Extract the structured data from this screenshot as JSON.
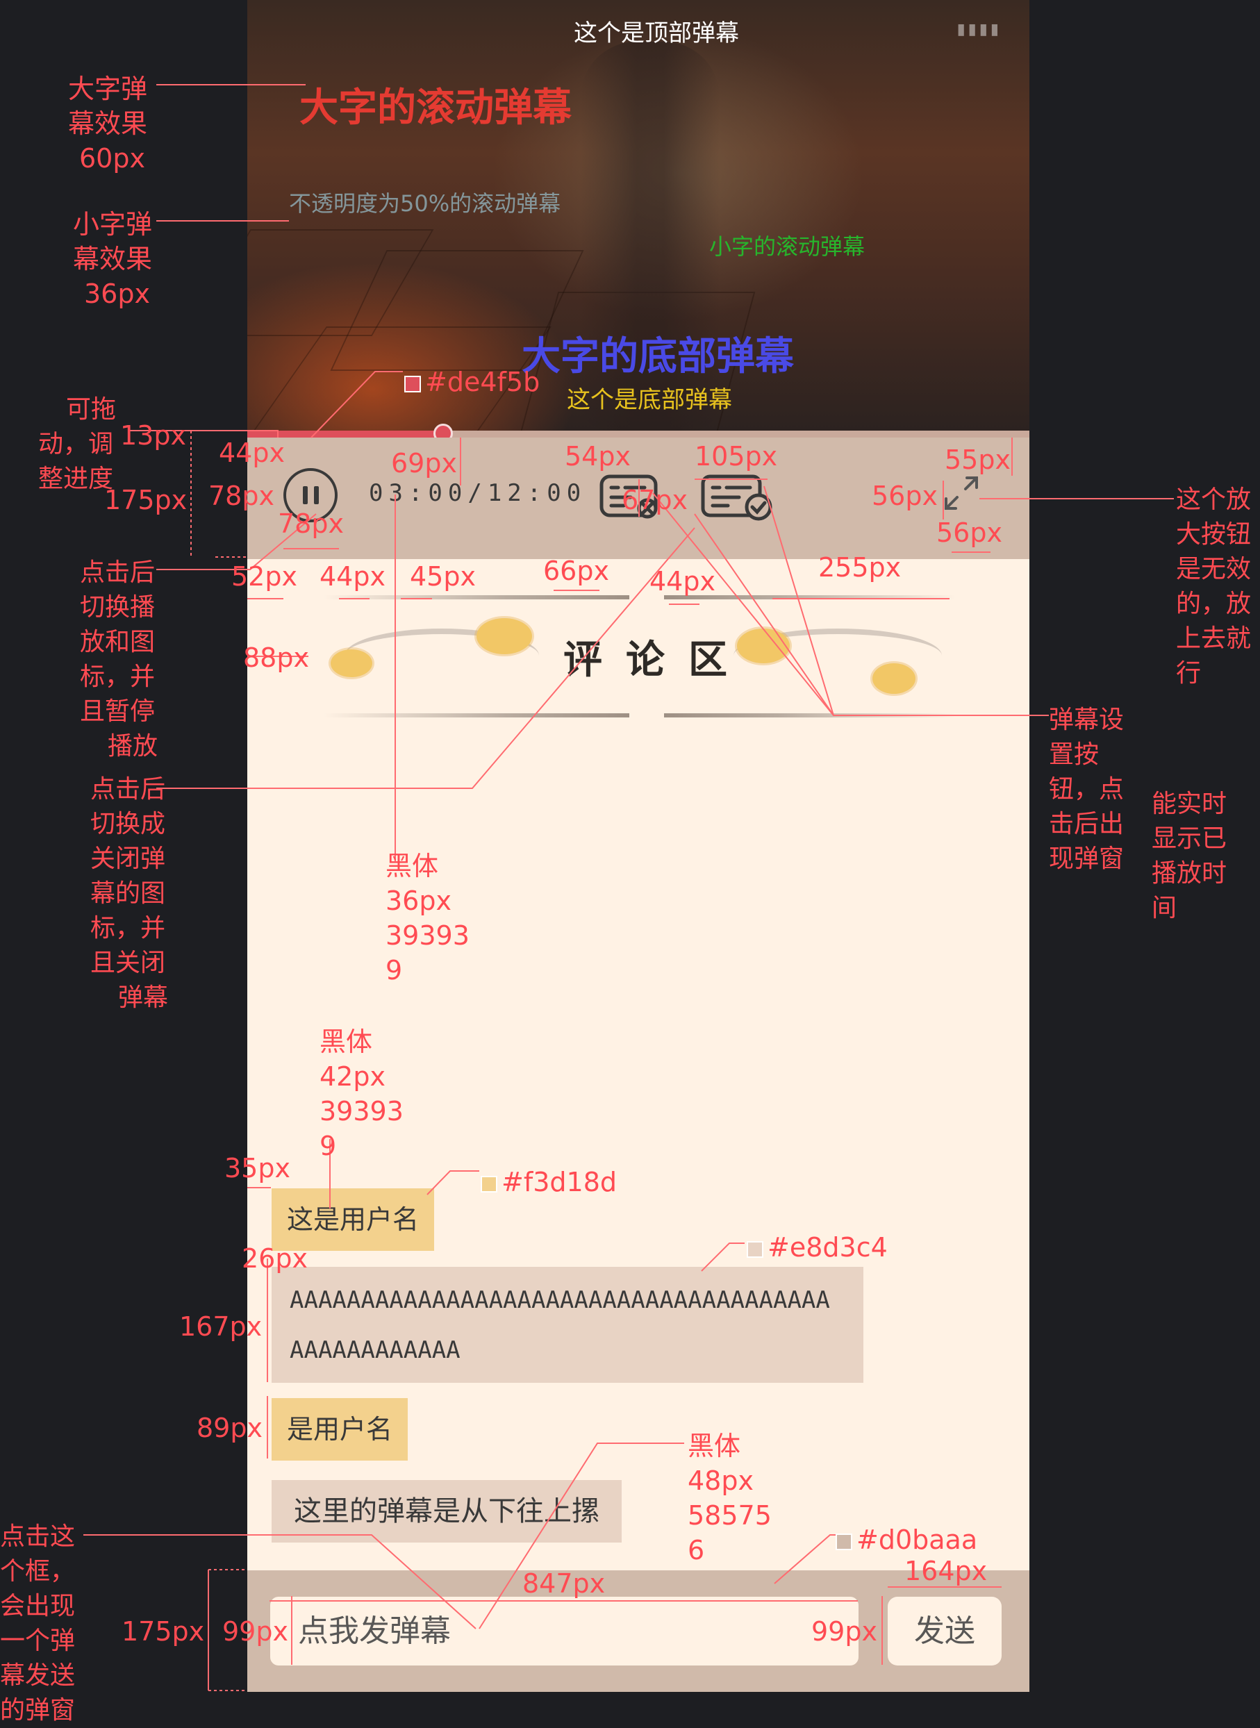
{
  "video": {
    "danmaku": {
      "top": "这个是顶部弹幕",
      "big_scroll": "大字的滚动弹幕",
      "half_opacity": "不透明度为50%的滚动弹幕",
      "small_scroll": "小字的滚动弹幕",
      "bottom_big": "大字的底部弹幕",
      "bottom": "这个是底部弹幕"
    },
    "progress": {
      "fraction": 0.25,
      "color": "#de4f5b"
    }
  },
  "controls": {
    "time": "03:00/12:00",
    "icons": [
      "pause-icon",
      "danmaku-toggle-icon",
      "danmaku-settings-icon",
      "fullscreen-icon"
    ]
  },
  "comments": {
    "title": "评论区",
    "items": [
      {
        "username": "这是用户名",
        "lines": [
          "AAAAAAAAAAAAAAAAAAAAAAAAAAAAAAAAAAAAAA",
          "AAAAAAAAAAAA"
        ]
      },
      {
        "username": "是用户名"
      }
    ],
    "danmaku_item": "这里的弹幕是从下往上摞"
  },
  "input": {
    "placeholder": "点我发弹幕",
    "send_label": "发送"
  },
  "colors": {
    "progress": "#de4f5b",
    "username_bg": "#f3d18d",
    "comment_bg": "#e8d3c4",
    "bar_bg": "#d0baaa",
    "text": "#393939"
  },
  "annotations": {
    "big_effect": [
      "大字弹",
      "幕效果",
      " 60px"
    ],
    "small_effect": [
      "小字弹",
      "幕效果",
      " 36px"
    ],
    "draggable": [
      "可拖",
      "动，调",
      "整进度"
    ],
    "pause_note": [
      "点击后",
      "切换播",
      "放和图",
      "标，并",
      "且暂停",
      "播放"
    ],
    "danmaku_toggle_note": [
      "点击后",
      "切换成",
      "关闭弹",
      "幕的图",
      "标，并",
      "且关闭",
      "弹幕"
    ],
    "fullscreen_note": [
      "这个放",
      "大按钮",
      "是无效",
      "的，放",
      "上去就",
      "行"
    ],
    "settings_note": [
      "弹幕设",
      "置按",
      "钮，点",
      "击后出",
      "现弹窗"
    ],
    "time_note": [
      "能实时",
      "显示已",
      "播放时",
      "间"
    ],
    "input_note": [
      "点击这",
      "个框，",
      "会出现",
      "一个弹",
      "幕发送",
      "的弹窗"
    ],
    "font_time": [
      "黑体",
      "36px",
      "39393",
      "9"
    ],
    "font_username": [
      "黑体",
      "42px",
      "39393",
      "9"
    ],
    "font_danmaku": [
      "黑体",
      "48px",
      "58575",
      "6"
    ],
    "color_progress": "#de4f5b",
    "color_username": "#f3d18d",
    "color_comment": "#e8d3c4",
    "color_bar": "#d0baaa",
    "dims": {
      "d13": "13px",
      "d44a": "44px",
      "d69": "69px",
      "d54": "54px",
      "d105": "105px",
      "d55": "55px",
      "d175a": "175px",
      "d78a": "78px",
      "d78b": "78px",
      "d67": "67px",
      "d56a": "56px",
      "d56b": "56px",
      "d52": "52px",
      "d44b": "44px",
      "d45": "45px",
      "d66": "66px",
      "d44c": "44px",
      "d255": "255px",
      "d88": "88px",
      "d35": "35px",
      "d26": "26px",
      "d167": "167px",
      "d89": "89px",
      "d847": "847px",
      "d164": "164px",
      "d175b": "175px",
      "d99a": "99px",
      "d99b": "99px"
    }
  }
}
